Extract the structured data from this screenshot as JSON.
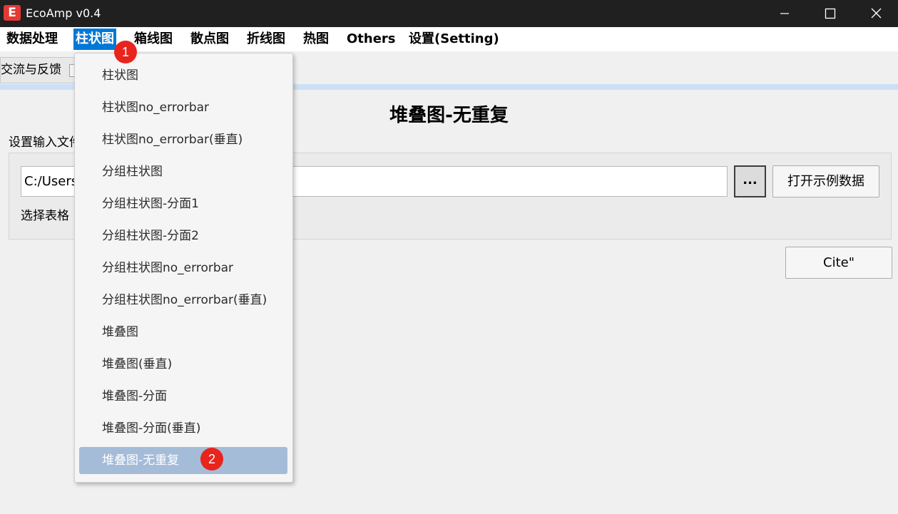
{
  "window": {
    "title": "EcoAmp v0.4",
    "logo_letter": "E",
    "controls": {
      "minimize_icon": "minimize-icon",
      "maximize_icon": "maximize-icon",
      "close_icon": "close-icon"
    }
  },
  "menubar": {
    "items": [
      {
        "label": "数据处理",
        "active": false
      },
      {
        "label": "柱状图",
        "active": true
      },
      {
        "label": "箱线图",
        "active": false
      },
      {
        "label": "散点图",
        "active": false
      },
      {
        "label": "折线图",
        "active": false
      },
      {
        "label": "热图",
        "active": false
      },
      {
        "label": "Others",
        "active": false
      },
      {
        "label": "设置(Setting)",
        "active": false
      }
    ]
  },
  "tabs": {
    "feedback_label": "交流与反馈"
  },
  "main": {
    "page_title": "堆叠图-无重复",
    "input_file_label": "设置输入文件",
    "file_path_value": "C:/Users",
    "browse_label": "...",
    "open_sample_label": "打开示例数据",
    "select_sheet_label": "选择表格",
    "cite_label": "Cite\""
  },
  "dropdown": {
    "items": [
      {
        "label": "柱状图",
        "selected": false
      },
      {
        "label": "柱状图no_errorbar",
        "selected": false
      },
      {
        "label": "柱状图no_errorbar(垂直)",
        "selected": false
      },
      {
        "label": "分组柱状图",
        "selected": false
      },
      {
        "label": "分组柱状图-分面1",
        "selected": false
      },
      {
        "label": "分组柱状图-分面2",
        "selected": false
      },
      {
        "label": "分组柱状图no_errorbar",
        "selected": false
      },
      {
        "label": "分组柱状图no_errorbar(垂直)",
        "selected": false
      },
      {
        "label": "堆叠图",
        "selected": false
      },
      {
        "label": "堆叠图(垂直)",
        "selected": false
      },
      {
        "label": "堆叠图-分面",
        "selected": false
      },
      {
        "label": "堆叠图-分面(垂直)",
        "selected": false
      },
      {
        "label": "堆叠图-无重复",
        "selected": true
      }
    ]
  },
  "badges": {
    "step1": "1",
    "step2": "2"
  },
  "colors": {
    "titlebar": "#202020",
    "menu_active": "#0078d7",
    "dropdown_selected": "#a4bcd8",
    "badge": "#e8241c",
    "tab_underline": "#cce0f5",
    "logo": "#e53935"
  }
}
